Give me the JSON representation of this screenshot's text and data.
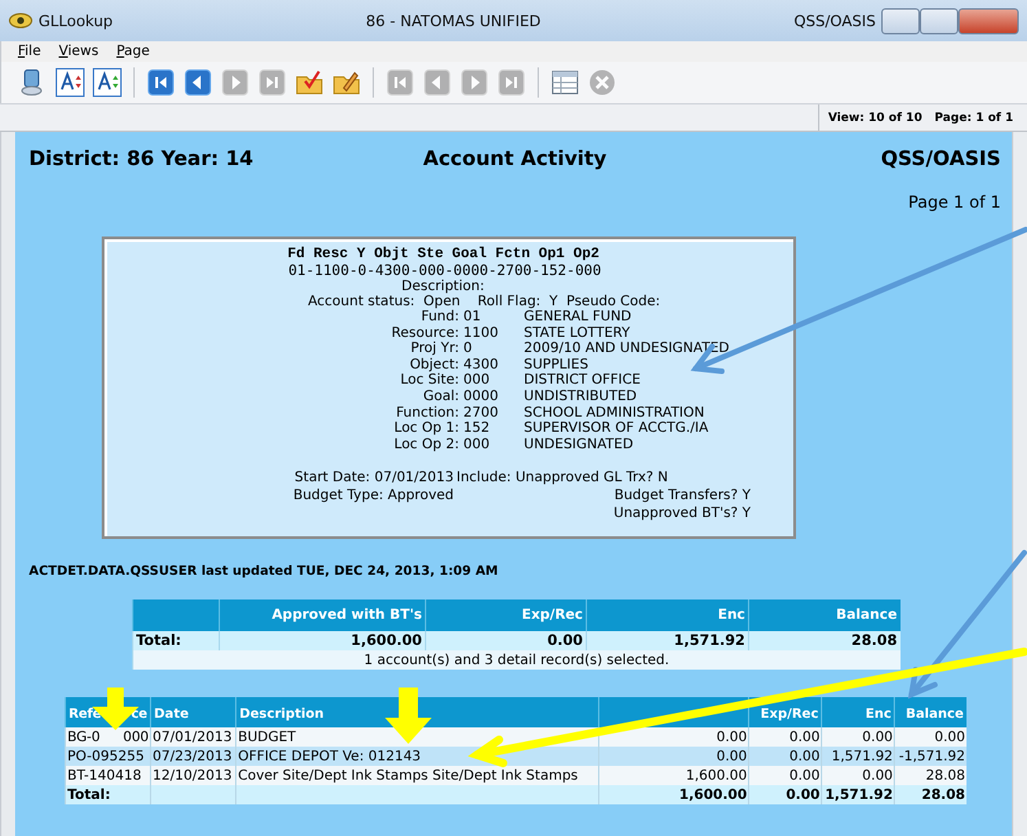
{
  "window": {
    "title": "GLLookup",
    "center_title": "86 - NATOMAS UNIFIED",
    "right_title": "QSS/OASIS"
  },
  "menu": [
    "File",
    "Views",
    "Page"
  ],
  "toolbar": [
    [
      {
        "kind": "computer",
        "disabled": false
      },
      {
        "kind": "font-up",
        "disabled": false
      },
      {
        "kind": "font-down",
        "disabled": false
      }
    ],
    [
      {
        "kind": "first",
        "disabled": false
      },
      {
        "kind": "prev",
        "disabled": false
      },
      {
        "kind": "next",
        "disabled": true
      },
      {
        "kind": "last",
        "disabled": true
      },
      {
        "kind": "folder-check",
        "disabled": false
      },
      {
        "kind": "folder-edit",
        "disabled": false
      }
    ],
    [
      {
        "kind": "first",
        "disabled": true
      },
      {
        "kind": "prev",
        "disabled": true
      },
      {
        "kind": "next",
        "disabled": true
      },
      {
        "kind": "last",
        "disabled": true
      }
    ],
    [
      {
        "kind": "table",
        "disabled": false
      },
      {
        "kind": "close",
        "disabled": true
      }
    ]
  ],
  "status": {
    "view": "View: 10 of 10",
    "page": "Page: 1 of 1"
  },
  "report": {
    "district": "District: 86 Year: 14",
    "title": "Account Activity",
    "system": "QSS/OASIS",
    "page": "Page 1 of 1",
    "account_box": {
      "header": "Fd Resc Y Objt Ste Goal Fctn Op1 Op2",
      "code": "01-1100-0-4300-000-0000-2700-152-000",
      "description": "Description:",
      "status_line": "Account status:  Open    Roll Flag:  Y  Pseudo Code:",
      "fields": [
        {
          "label": "Fund:",
          "code": "01",
          "name": "GENERAL FUND"
        },
        {
          "label": "Resource:",
          "code": "1100",
          "name": "STATE LOTTERY"
        },
        {
          "label": "Proj Yr:",
          "code": "0",
          "name": "2009/10 AND UNDESIGNATED"
        },
        {
          "label": "Object:",
          "code": "4300",
          "name": "SUPPLIES"
        },
        {
          "label": "Loc Site:",
          "code": "000",
          "name": "DISTRICT OFFICE"
        },
        {
          "label": "Goal:",
          "code": "0000",
          "name": "UNDISTRIBUTED"
        },
        {
          "label": "Function:",
          "code": "2700",
          "name": "SCHOOL ADMINISTRATION"
        },
        {
          "label": "Loc Op 1:",
          "code": "152",
          "name": "SUPERVISOR OF ACCTG./IA"
        },
        {
          "label": "Loc Op 2:",
          "code": "000",
          "name": "UNDESIGNATED"
        }
      ],
      "start_date": "Start Date: 07/01/2013",
      "include": "Include: Unapproved GL Trx? N",
      "budget_type": "Budget Type: Approved",
      "budget_transfers": "Budget Transfers? Y",
      "unapproved": "Unapproved BT's? Y"
    },
    "updated": "ACTDET.DATA.QSSUSER last updated TUE, DEC 24, 2013, 1:09 AM",
    "summary": {
      "columns": [
        "Approved with BT's",
        "Exp/Rec",
        "Enc",
        "Balance"
      ],
      "total": [
        "Total:",
        "1,600.00",
        "0.00",
        "1,571.92",
        "28.08"
      ],
      "note": "1 account(s) and 3 detail record(s) selected."
    },
    "detail": {
      "columns": [
        [
          "Refe",
          "ce"
        ],
        "Date",
        "Description",
        null,
        "Exp/Rec",
        "Enc",
        "Balance"
      ],
      "rows": [
        [
          [
            "BG-0",
            "000"
          ],
          "07/01/2013",
          "BUDGET",
          "0.00",
          "0.00",
          "0.00",
          "0.00"
        ],
        [
          "PO-095255",
          "07/23/2013",
          "OFFICE DEPOT Ve: 012143",
          "0.00",
          "0.00",
          "1,571.92",
          "-1,571.92"
        ],
        [
          "BT-140418",
          "12/10/2013",
          "Cover Site/Dept Ink Stamps Site/Dept Ink Stamps",
          "1,600.00",
          "0.00",
          "0.00",
          "28.08"
        ]
      ],
      "total": {
        "label": "Total:",
        "values": [
          "1,600.00",
          "0.00",
          "1,571.92",
          "28.08"
        ]
      }
    }
  }
}
